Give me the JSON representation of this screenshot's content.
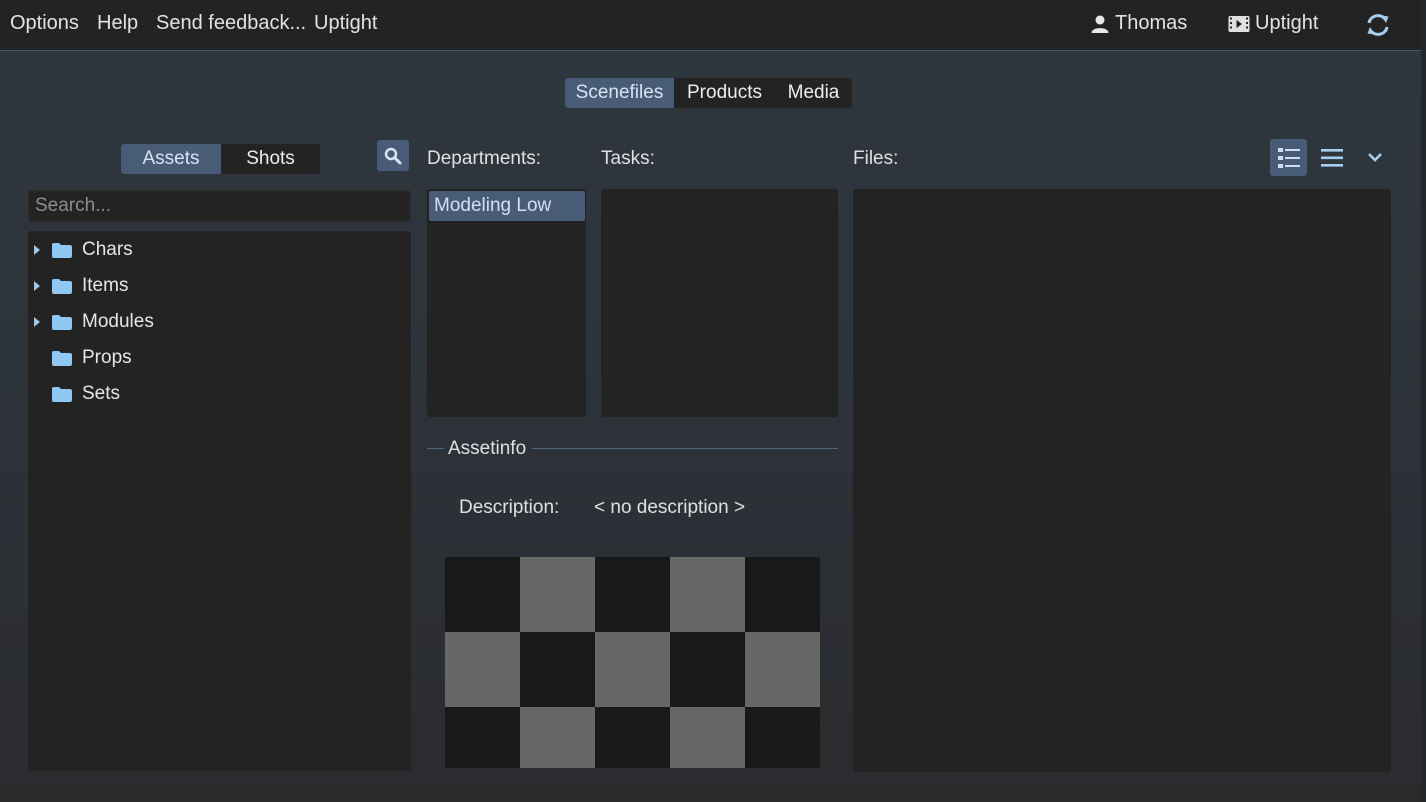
{
  "menubar": {
    "items": [
      "Options",
      "Help",
      "Send feedback...",
      "Uptight"
    ],
    "user": "Thomas",
    "project": "Uptight"
  },
  "top_tabs": [
    "Scenefiles",
    "Products",
    "Media"
  ],
  "entity_tabs": [
    "Assets",
    "Shots"
  ],
  "search": {
    "placeholder": "Search..."
  },
  "tree": {
    "items": [
      {
        "label": "Chars",
        "expandable": true
      },
      {
        "label": "Items",
        "expandable": true
      },
      {
        "label": "Modules",
        "expandable": true
      },
      {
        "label": "Props",
        "expandable": false
      },
      {
        "label": "Sets",
        "expandable": false
      }
    ]
  },
  "labels": {
    "departments": "Departments:",
    "tasks": "Tasks:",
    "files": "Files:",
    "assetinfo": "Assetinfo",
    "description_label": "Description:",
    "description_value": "< no description >"
  },
  "departments": [
    "Modeling Low"
  ],
  "colors": {
    "accent": "#485c77",
    "icon": "#9bc7ea",
    "panel": "#232323"
  }
}
